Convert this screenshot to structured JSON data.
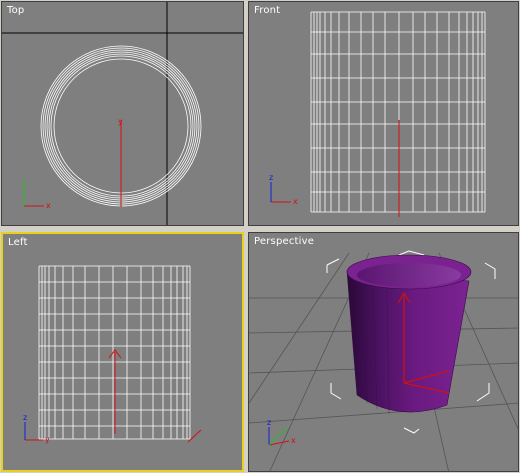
{
  "viewports": {
    "top": {
      "label": "Top"
    },
    "front": {
      "label": "Front"
    },
    "left": {
      "label": "Left"
    },
    "perspective": {
      "label": "Perspective"
    }
  },
  "axes": {
    "x": "x",
    "y": "y",
    "z": "z"
  },
  "colors": {
    "viewport_bg": "#7f7f7f",
    "grid": "#4a4a4a",
    "wire": "#ffffff",
    "axis_x": "#d01010",
    "axis_y": "#20c020",
    "axis_z": "#1020d0",
    "active_border": "#e6d21c",
    "object_purple": "#6a1a80"
  },
  "active_viewport": "left",
  "object": {
    "name": "tube",
    "icon": "cylinder-mesh-icon"
  }
}
